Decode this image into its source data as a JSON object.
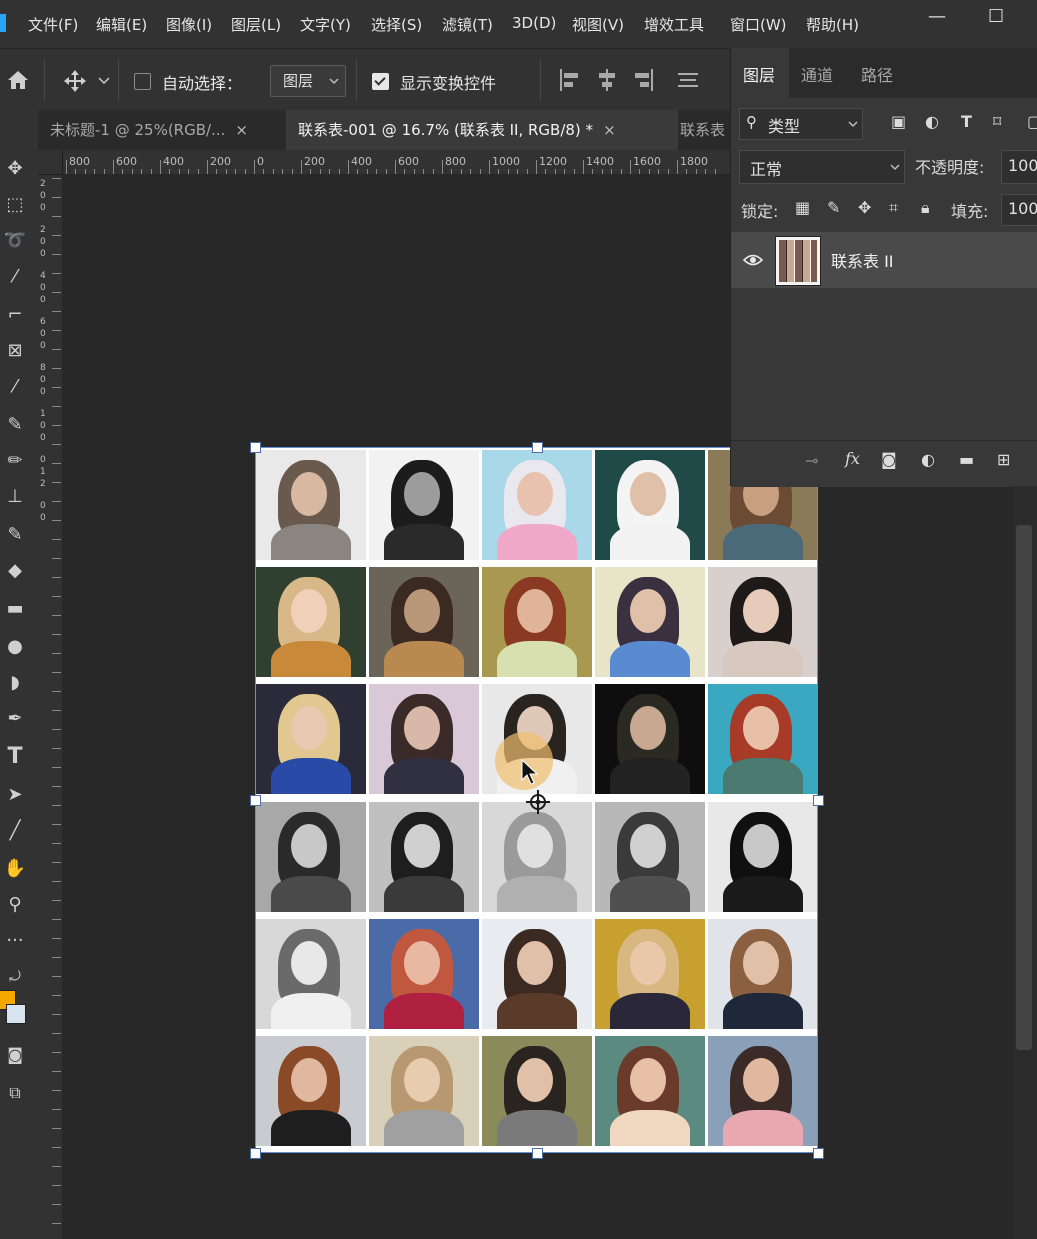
{
  "menu": {
    "items": [
      "文件(F)",
      "编辑(E)",
      "图像(I)",
      "图层(L)",
      "文字(Y)",
      "选择(S)",
      "滤镜(T)",
      "3D(D)",
      "视图(V)",
      "增效工具",
      "窗口(W)",
      "帮助(H)"
    ],
    "minimize": "—",
    "maximize": "☐"
  },
  "options": {
    "move_icon": "move-icon",
    "auto_select_label": "自动选择：",
    "auto_select_checked": false,
    "target_value": "图层",
    "show_transform_label": "显示变换控件",
    "show_transform_checked": true
  },
  "tabs": [
    {
      "label": "未标题-1 @ 25%(RGB/...",
      "close": "×",
      "active": false
    },
    {
      "label": "联系表-001 @ 16.7% (联系表 II, RGB/8) *",
      "close": "×",
      "active": true
    },
    {
      "label": "联系表",
      "close": "",
      "active": false
    }
  ],
  "ruler": {
    "h_labels": [
      "800",
      "600",
      "400",
      "200",
      "0",
      "200",
      "400",
      "600",
      "800",
      "1000",
      "1200",
      "1400",
      "1600",
      "1800"
    ],
    "v_labels": [
      "2",
      "0",
      "0",
      "2",
      "0",
      "0",
      "4",
      "0",
      "0",
      "6",
      "0",
      "0",
      "8",
      "0",
      "0",
      "1",
      "0",
      "0",
      "0",
      "1",
      "2",
      "0",
      "0"
    ]
  },
  "layers_panel": {
    "tabs": [
      "图层",
      "通道",
      "路径"
    ],
    "filter_kind": "类型",
    "blend_mode": "正常",
    "opacity_label": "不透明度:",
    "opacity_value": "100",
    "lock_label": "锁定:",
    "fill_label": "填充:",
    "fill_value": "100",
    "layer_name": "联系表 II",
    "footer_icons": [
      "link-icon",
      "fx-icon",
      "mask-icon",
      "adjustment-icon",
      "folder-icon",
      "new-layer-icon"
    ],
    "footer_fx": "fx"
  },
  "contact_sheet": {
    "columns": 5,
    "rows": 6,
    "cells": [
      {
        "bg": "#e9e9ea",
        "hair": "#6a5a4e",
        "skin": "#d8b8a0",
        "cloth": "#8a8580"
      },
      {
        "bg": "#f2f2f2",
        "hair": "#1c1c1c",
        "skin": "#9c9c9c",
        "cloth": "#2a2a2a"
      },
      {
        "bg": "#a9d8e8",
        "hair": "#e8e8ee",
        "skin": "#e8c2ae",
        "cloth": "#f0a8c8"
      },
      {
        "bg": "#1f4a48",
        "hair": "#f4f4f4",
        "skin": "#e0c0a8",
        "cloth": "#f2f2f2"
      },
      {
        "bg": "#8a7a58",
        "hair": "#6b4b34",
        "skin": "#c8a080",
        "cloth": "#4a6a7a"
      },
      {
        "bg": "#2f4030",
        "hair": "#d8b888",
        "skin": "#f0d0b8",
        "cloth": "#c88a3a"
      },
      {
        "bg": "#6b6458",
        "hair": "#3b2a22",
        "skin": "#b89878",
        "cloth": "#b88a50"
      },
      {
        "bg": "#a89850",
        "hair": "#8a3a22",
        "skin": "#e0b498",
        "cloth": "#d8e0b0"
      },
      {
        "bg": "#e8e4c8",
        "hair": "#3a3040",
        "skin": "#e0c0a8",
        "cloth": "#5a8ad0"
      },
      {
        "bg": "#d8d0cc",
        "hair": "#1e1a1a",
        "skin": "#e6cbbb",
        "cloth": "#d8c8c0"
      },
      {
        "bg": "#2a2a3a",
        "hair": "#e0c890",
        "skin": "#e8c8b0",
        "cloth": "#2a4aa8"
      },
      {
        "bg": "#d8c8d8",
        "hair": "#3a2a28",
        "skin": "#d8b8a8",
        "cloth": "#303040"
      },
      {
        "bg": "#e8e8e8",
        "hair": "#2a2420",
        "skin": "#e0c8b8",
        "cloth": "#f0f0f0"
      },
      {
        "bg": "#0e0e0e",
        "hair": "#2a2a22",
        "skin": "#c8a890",
        "cloth": "#222222"
      },
      {
        "bg": "#3aa8c0",
        "hair": "#a83a28",
        "skin": "#e8c0a8",
        "cloth": "#4a7a70"
      },
      {
        "bg": "#a8a8a8",
        "hair": "#2a2a2a",
        "skin": "#c8c8c8",
        "cloth": "#4a4a4a"
      },
      {
        "bg": "#c0c0c0",
        "hair": "#1e1e1e",
        "skin": "#d0d0d0",
        "cloth": "#3a3a3a"
      },
      {
        "bg": "#d8d8d8",
        "hair": "#9a9a9a",
        "skin": "#e0e0e0",
        "cloth": "#b0b0b0"
      },
      {
        "bg": "#b8b8b8",
        "hair": "#3a3a3a",
        "skin": "#d0d0d0",
        "cloth": "#505050"
      },
      {
        "bg": "#e8e8e8",
        "hair": "#101010",
        "skin": "#c8c8c8",
        "cloth": "#1a1a1a"
      },
      {
        "bg": "#d8d8d8",
        "hair": "#6a6a6a",
        "skin": "#e8e8e8",
        "cloth": "#f0f0f0"
      },
      {
        "bg": "#4a6aa8",
        "hair": "#c05840",
        "skin": "#e8b8a0",
        "cloth": "#b02040"
      },
      {
        "bg": "#e8ecf0",
        "hair": "#3a2a22",
        "skin": "#e0c0a8",
        "cloth": "#5a3a28"
      },
      {
        "bg": "#c8a030",
        "hair": "#d8b880",
        "skin": "#e8c8a8",
        "cloth": "#2a2838"
      },
      {
        "bg": "#e0e4e8",
        "hair": "#8a6040",
        "skin": "#e0c0a8",
        "cloth": "#1e2838"
      },
      {
        "bg": "#c8ccd0",
        "hair": "#8a4a28",
        "skin": "#e0b8a0",
        "cloth": "#1e1e1e"
      },
      {
        "bg": "#d8d0b8",
        "hair": "#b89870",
        "skin": "#e8ccb0",
        "cloth": "#a0a0a0"
      },
      {
        "bg": "#8a8a5a",
        "hair": "#2a2420",
        "skin": "#e0c0a8",
        "cloth": "#7a7a7a"
      },
      {
        "bg": "#5a8a80",
        "hair": "#6a3a2a",
        "skin": "#e8c0a8",
        "cloth": "#f0d8c0"
      },
      {
        "bg": "#8aa0b8",
        "hair": "#3a2a28",
        "skin": "#e0b8a0",
        "cloth": "#e8a8b0"
      }
    ]
  },
  "colors": {
    "foreground": "#f5a800",
    "background": "#d8e4f0"
  }
}
